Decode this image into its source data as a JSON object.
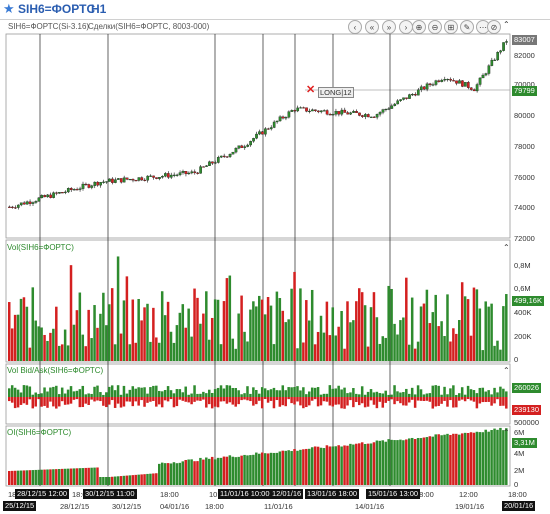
{
  "window": {
    "symbol": "SIH6=ФОРТС",
    "timeframe": "H1"
  },
  "info": {
    "main": "SIH6=ФОРТС(Si-3.16)",
    "deals": "Сделки(SIH6=ФОРТС, 8003-000)"
  },
  "toolbar": [
    "‹",
    "«",
    "»",
    "›",
    "⊕",
    "⊖",
    "⊞",
    "✎",
    "⋯",
    "⊘"
  ],
  "panes": {
    "vol": "Vol(SIH6=ФОРТС)",
    "bidask": "Vol Bid/Ask(SIH6=ФОРТС)",
    "oi": "OI(SIH6=ФОРТС)"
  },
  "price_axis": [
    "82000",
    "80000",
    "78000",
    "76000",
    "74000",
    "72000",
    "70000"
  ],
  "price_tags": {
    "top": "83007",
    "current": "79799"
  },
  "vol_axis": [
    "0,8M",
    "0,6M",
    "400K",
    "200K",
    "0"
  ],
  "vol_tag": "499,16K",
  "bidask_axis": [
    "500000"
  ],
  "bidask_tags": {
    "bid": "260026",
    "ask": "239130"
  },
  "oi_axis": [
    "6M",
    "4M",
    "2M",
    "0"
  ],
  "oi_tag": "3,31M",
  "position": {
    "label": "LONG|12"
  },
  "x_axis": {
    "labels": [
      "18:00",
      "28/12/15",
      "18:00",
      "30/12/15",
      "18:00",
      "04/01/16",
      "10",
      "18:00",
      "11/01/16",
      "18:00",
      "12/01/16",
      "18:00",
      "13/01/16",
      "14/01/16",
      "18:00",
      "15/01/16",
      "18:00",
      "19/01/16",
      "12:00",
      "18:00",
      "20/01/16"
    ],
    "highlights": [
      "25/12/15",
      "28/12/15 12:00",
      "30/12/15 11:00",
      "11/01/16 10:00",
      "12/01/16",
      "13/01/16 18:00",
      "15/01/16 13:00",
      "20/01/16"
    ]
  },
  "colors": {
    "up": "#2e8b2e",
    "down": "#d42020",
    "bg": "#ffffff",
    "grid": "#333333"
  }
}
